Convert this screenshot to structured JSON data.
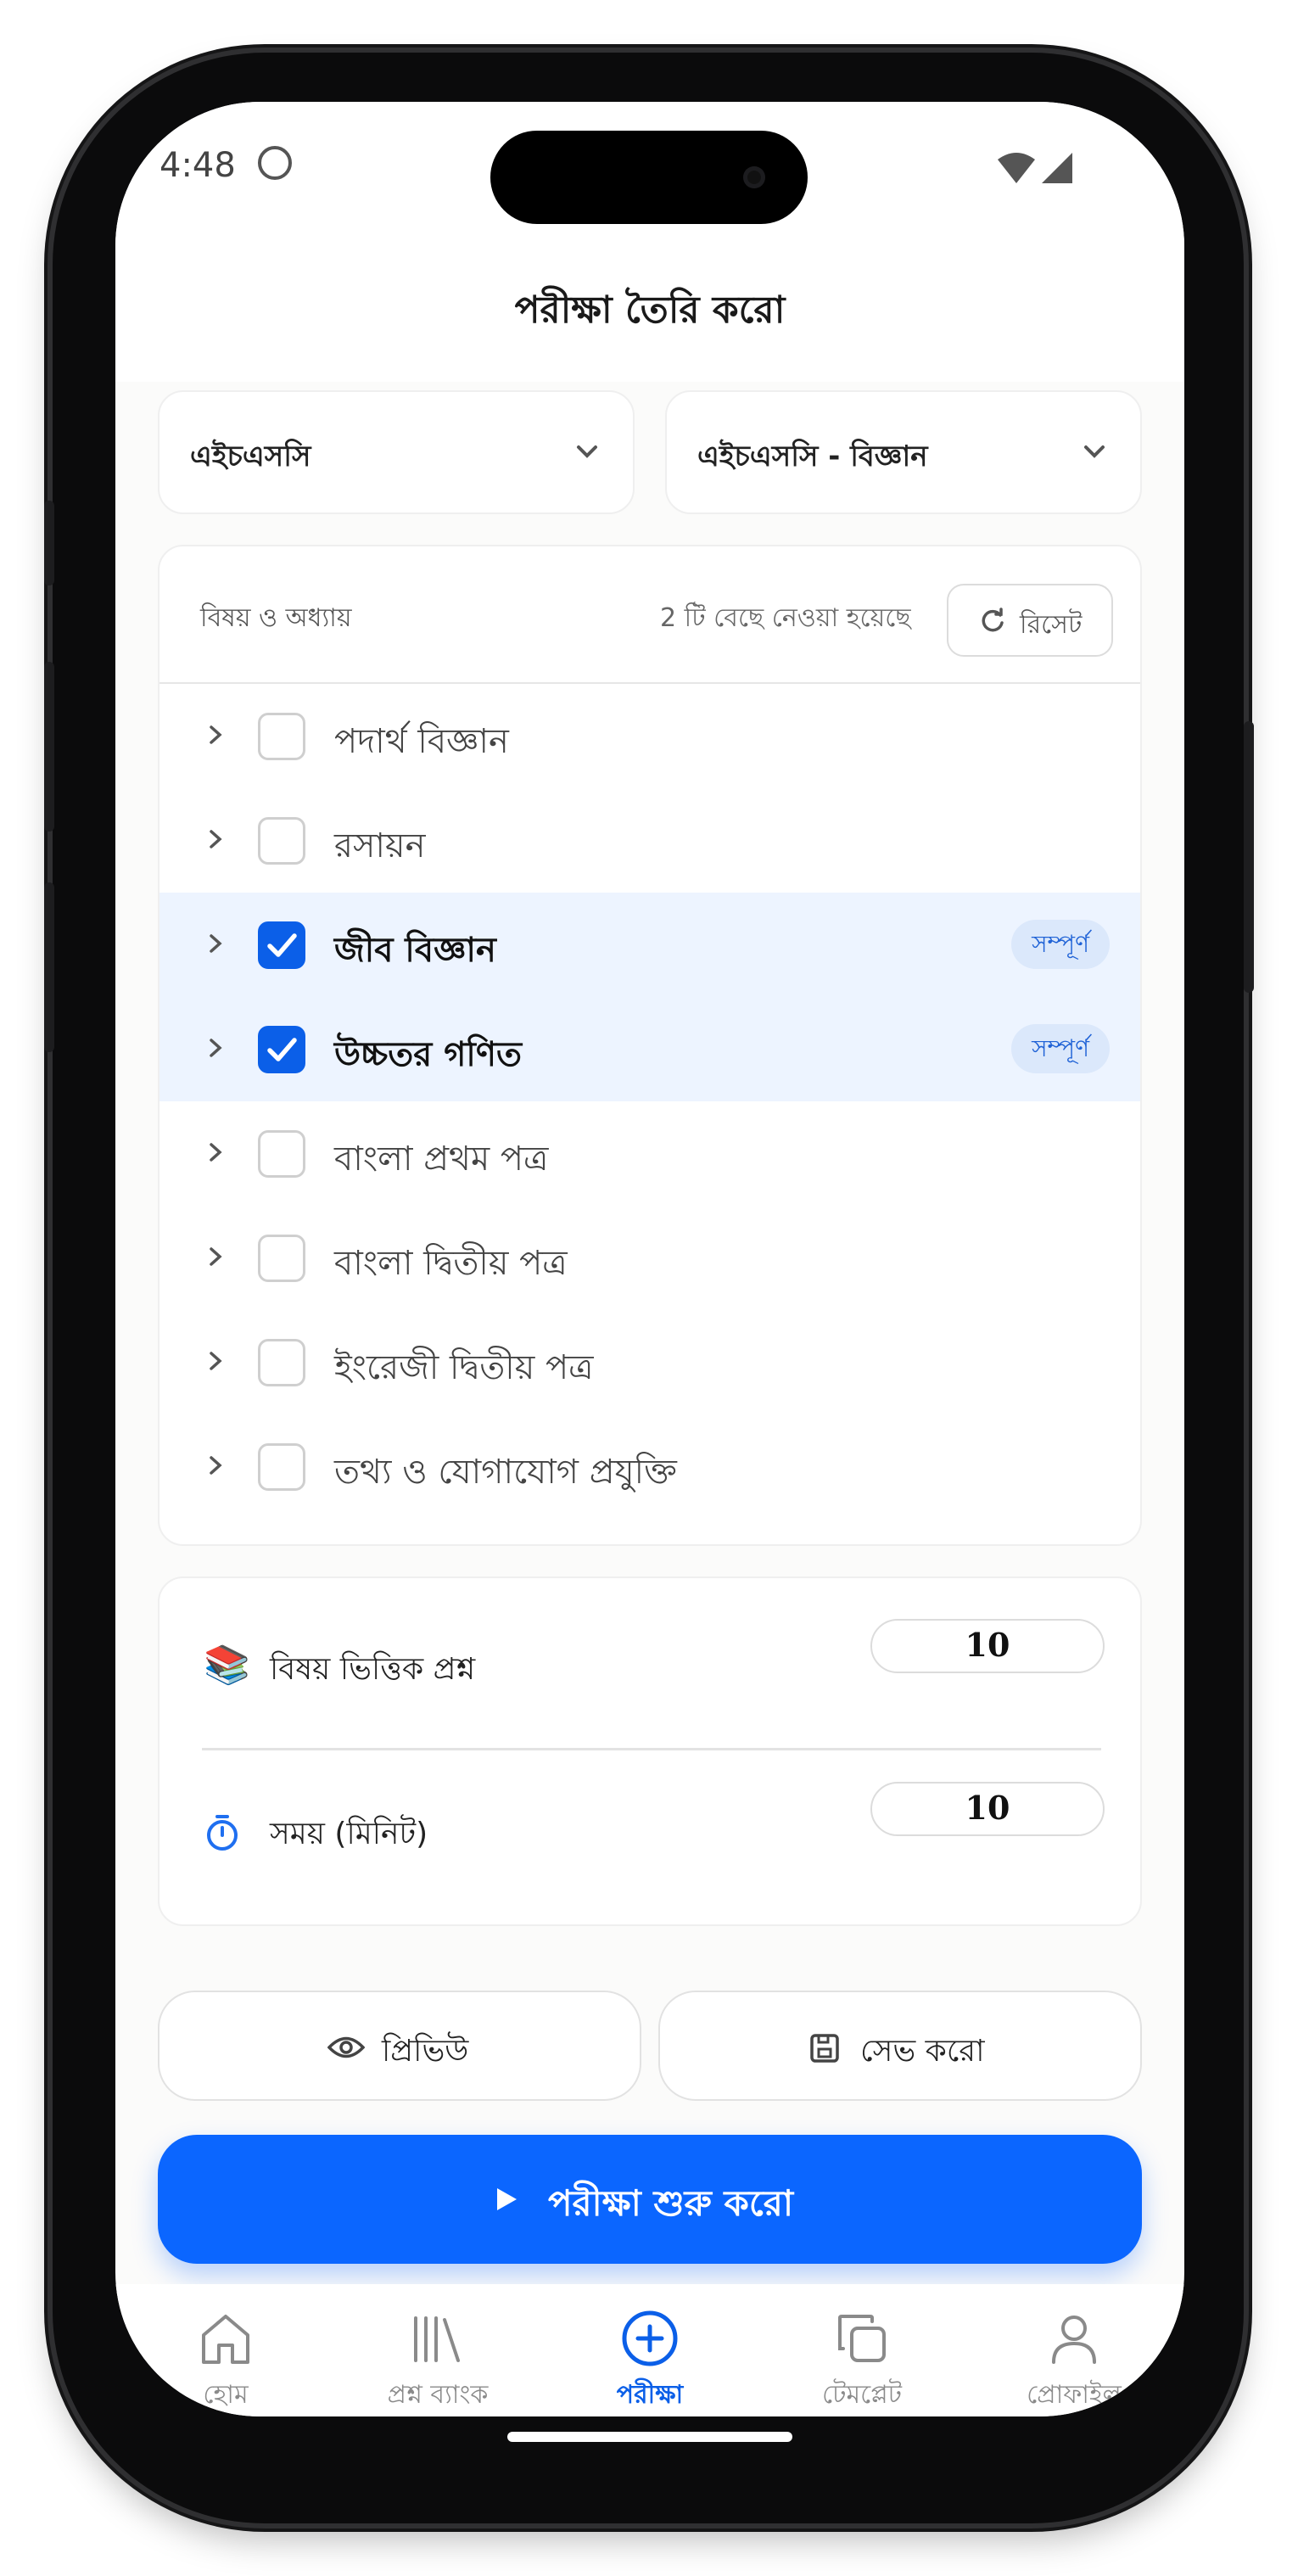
{
  "status": {
    "time": "4:48"
  },
  "header": {
    "title": "পরীক্ষা তৈরি করো"
  },
  "filters": {
    "level": "এইচএসসি",
    "group": "এইচএসসি - বিজ্ঞান"
  },
  "subjects": {
    "heading": "বিষয় ও অধ্যায়",
    "selected_count": "2 টি বেছে নেওয়া হয়েছে",
    "reset_label": "রিসেট",
    "items": [
      {
        "label": "পদার্থ বিজ্ঞান",
        "checked": false,
        "badge": ""
      },
      {
        "label": "রসায়ন",
        "checked": false,
        "badge": ""
      },
      {
        "label": "জীব বিজ্ঞান",
        "checked": true,
        "badge": "সম্পূর্ণ"
      },
      {
        "label": "উচ্চতর গণিত",
        "checked": true,
        "badge": "সম্পূর্ণ"
      },
      {
        "label": "বাংলা প্রথম পত্র",
        "checked": false,
        "badge": ""
      },
      {
        "label": "বাংলা দ্বিতীয় পত্র",
        "checked": false,
        "badge": ""
      },
      {
        "label": "ইংরেজী দ্বিতীয় পত্র",
        "checked": false,
        "badge": ""
      },
      {
        "label": "তথ্য ও যোগাযোগ প্রযুক্তি",
        "checked": false,
        "badge": ""
      }
    ]
  },
  "settings": {
    "questions_icon": "📚",
    "questions_label": "বিষয় ভিত্তিক প্রশ্ন",
    "questions_value": "10",
    "time_label": "সময় (মিনিট)",
    "time_value": "10"
  },
  "actions": {
    "preview_label": "প্রিভিউ",
    "save_label": "সেভ করো",
    "start_label": "পরীক্ষা শুরু করো"
  },
  "tabs": [
    {
      "label": "হোম",
      "icon": "home-icon",
      "active": false
    },
    {
      "label": "প্রশ্ন ব্যাংক",
      "icon": "library-icon",
      "active": false
    },
    {
      "label": "পরীক্ষা",
      "icon": "plus-circle-icon",
      "active": true
    },
    {
      "label": "টেমপ্লেট",
      "icon": "copy-icon",
      "active": false
    },
    {
      "label": "প্রোফাইল",
      "icon": "user-icon",
      "active": false
    }
  ],
  "colors": {
    "accent": "#0b66ff",
    "selected_row": "#edf4ff",
    "badge_bg": "#dbe8fb"
  }
}
